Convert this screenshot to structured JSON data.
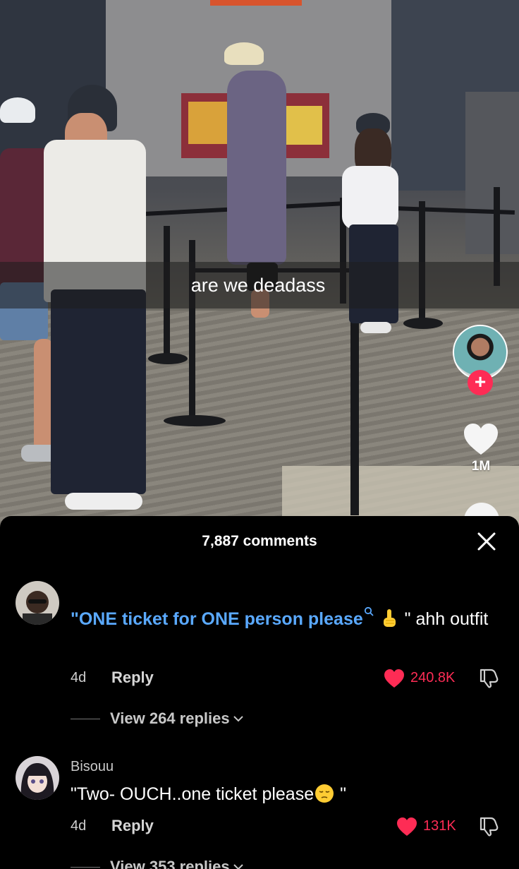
{
  "video": {
    "caption": "are we deadass",
    "creator_avatar_icon": "creator-avatar",
    "follow_label": "+",
    "like_count": "1M"
  },
  "comments_sheet": {
    "title": "7,887 comments",
    "close_icon": "close-icon",
    "comments": [
      {
        "username": "",
        "text_highlight": "\"ONE ticket for ONE person please",
        "search_icon": "search-icon",
        "emoji": "pointing-up-emoji",
        "text_rest": " \" ahh outfit",
        "age": "4d",
        "reply_label": "Reply",
        "likes": "240.8K",
        "replies_label": "View 264 replies"
      },
      {
        "username": "Bisouu",
        "text": "\"Two- OUCH..one ticket please",
        "emoji": "pensive-face-emoji",
        "text_end": " \"",
        "age": "4d",
        "reply_label": "Reply",
        "likes": "131K",
        "replies_label": "View 353 replies"
      }
    ]
  },
  "colors": {
    "accent_red": "#fe2c55",
    "link_blue": "#5aa9ff",
    "sheet_bg": "#000000"
  }
}
